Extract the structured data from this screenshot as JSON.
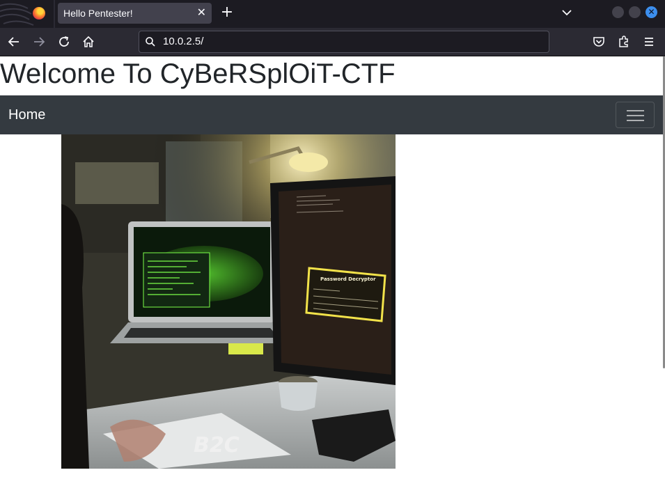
{
  "browser": {
    "tab_title": "Hello Pentester!",
    "url": "10.0.2.5/"
  },
  "page": {
    "heading": "Welcome To CyBeRSplOiT-CTF",
    "nav_brand": "Home",
    "hero_watermark": "B2C",
    "hero_screen_title": "Password Decryptor"
  },
  "colors": {
    "navbar_bg": "#343a40",
    "accent": "#3c8eed"
  }
}
